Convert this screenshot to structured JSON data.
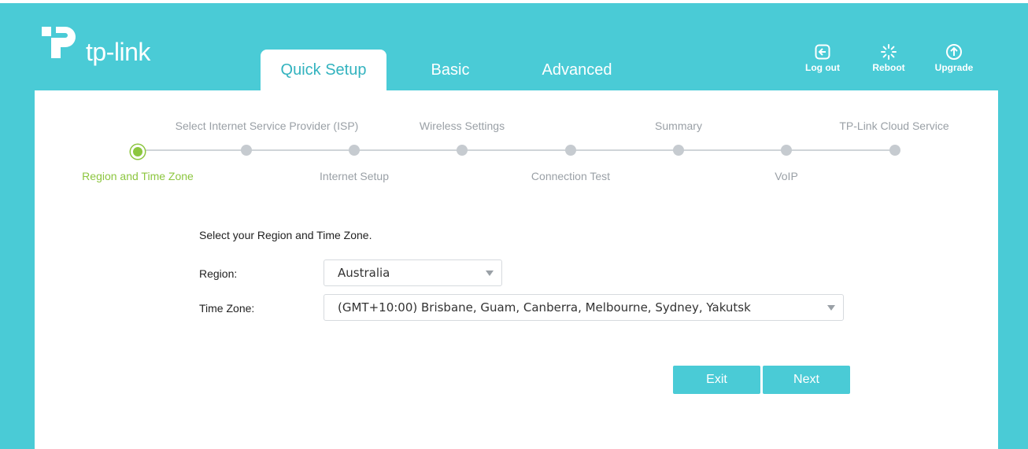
{
  "header": {
    "logo_text": "tp-link",
    "tabs": [
      {
        "label": "Quick Setup",
        "active": true
      },
      {
        "label": "Basic",
        "active": false
      },
      {
        "label": "Advanced",
        "active": false
      }
    ],
    "actions": [
      {
        "label": "Log out",
        "icon": "logout-icon"
      },
      {
        "label": "Reboot",
        "icon": "reboot-icon"
      },
      {
        "label": "Upgrade",
        "icon": "upgrade-icon"
      }
    ]
  },
  "stepper": {
    "steps": [
      {
        "label": "Region and Time Zone",
        "active": true
      },
      {
        "label": "Select Internet Service Provider (ISP)",
        "active": false
      },
      {
        "label": "Internet Setup",
        "active": false
      },
      {
        "label": "Wireless Settings",
        "active": false
      },
      {
        "label": "Connection Test",
        "active": false
      },
      {
        "label": "Summary",
        "active": false
      },
      {
        "label": "VoIP",
        "active": false
      },
      {
        "label": "TP-Link Cloud Service",
        "active": false
      }
    ]
  },
  "form": {
    "intro": "Select your Region and Time Zone.",
    "region_label": "Region:",
    "region_value": "Australia",
    "timezone_label": "Time Zone:",
    "timezone_value": "(GMT+10:00) Brisbane, Guam, Canberra, Melbourne, Sydney, Yakutsk"
  },
  "buttons": {
    "exit": "Exit",
    "next": "Next"
  },
  "colors": {
    "brand": "#4acbd6",
    "active_step": "#8cc63f",
    "inactive_step": "#c6cbd0"
  }
}
